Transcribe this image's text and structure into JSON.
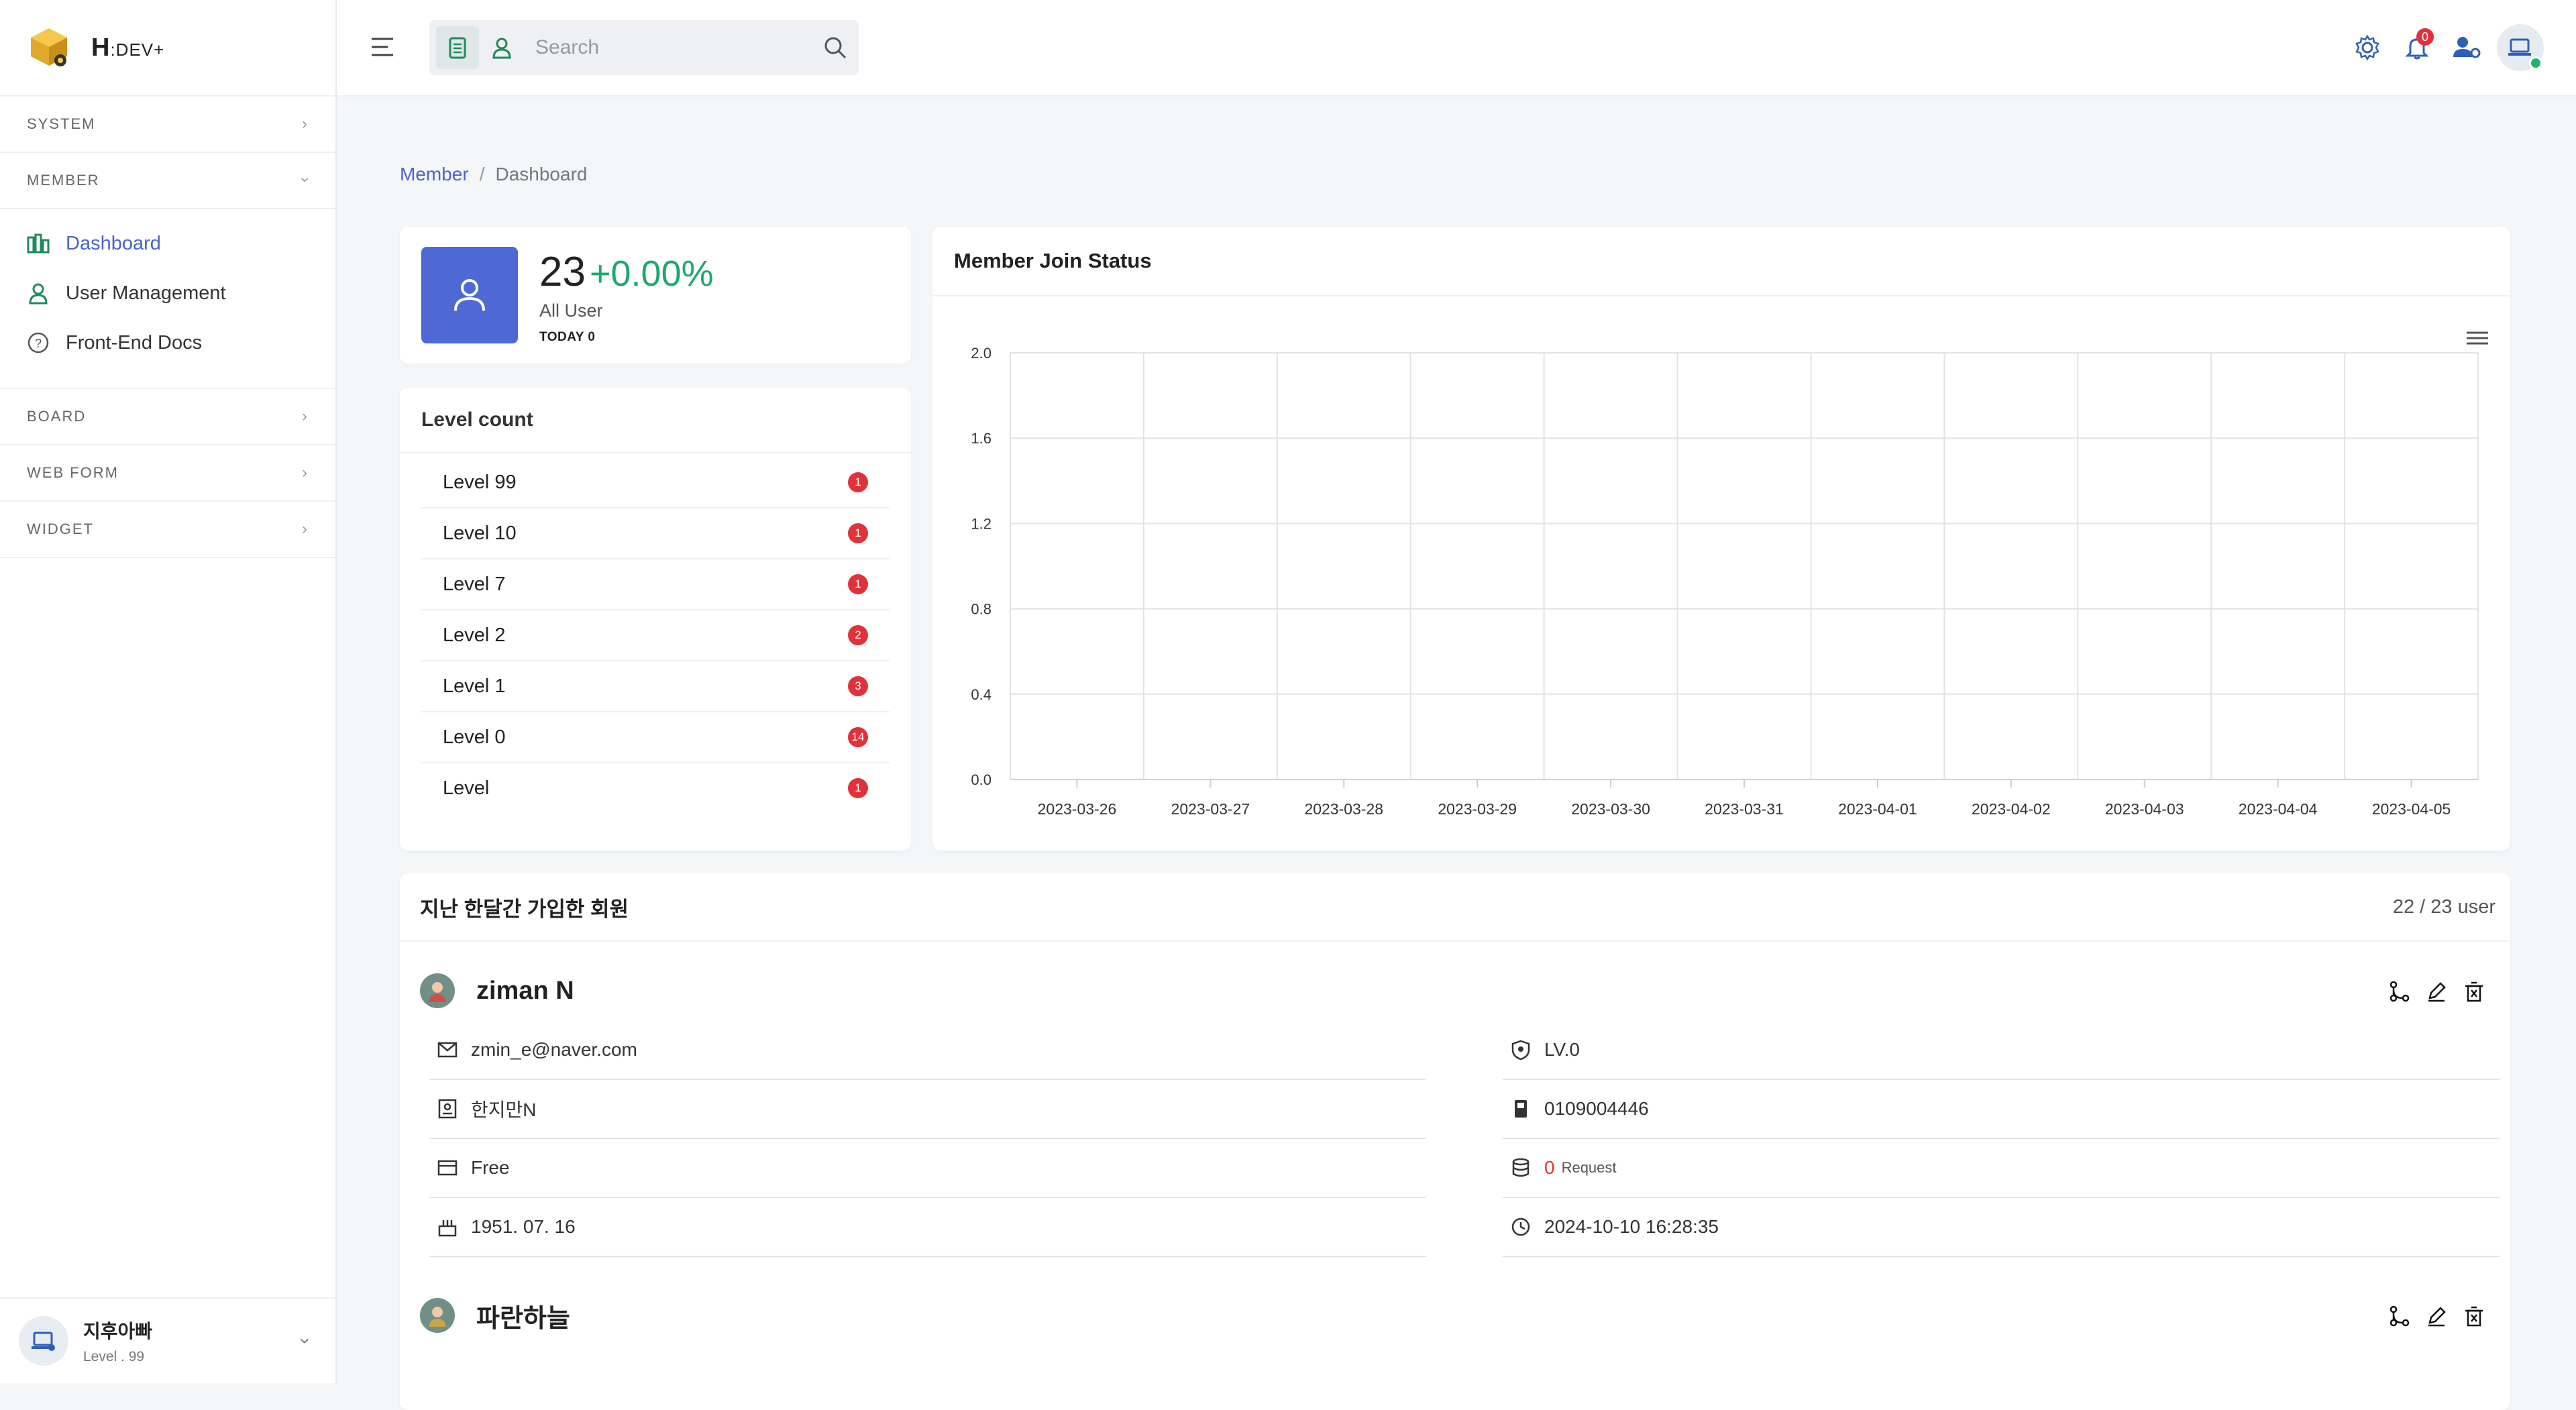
{
  "brand": {
    "name": "H",
    "suffix": ":DEV+"
  },
  "sidebar": {
    "sections": [
      {
        "label": "SYSTEM"
      },
      {
        "label": "MEMBER"
      },
      {
        "label": "BOARD"
      },
      {
        "label": "WEB FORM"
      },
      {
        "label": "WIDGET"
      }
    ],
    "member_items": [
      {
        "label": "Dashboard",
        "icon": "bar-chart-icon",
        "active": true
      },
      {
        "label": "User Management",
        "icon": "user-icon"
      },
      {
        "label": "Front-End Docs",
        "icon": "help-circle-icon"
      }
    ],
    "footer": {
      "name": "지후아빠",
      "level": "Level . 99"
    }
  },
  "header": {
    "search_placeholder": "Search",
    "notification_count": "0"
  },
  "breadcrumb": {
    "parent": "Member",
    "current": "Dashboard"
  },
  "stat": {
    "count": "23",
    "change": "+0.00%",
    "label": "All User",
    "today": "TODAY 0"
  },
  "level_count": {
    "title": "Level count",
    "rows": [
      {
        "label": "Level 99",
        "count": "1"
      },
      {
        "label": "Level 10",
        "count": "1"
      },
      {
        "label": "Level 7",
        "count": "1"
      },
      {
        "label": "Level 2",
        "count": "2"
      },
      {
        "label": "Level 1",
        "count": "3"
      },
      {
        "label": "Level 0",
        "count": "14"
      },
      {
        "label": "Level",
        "count": "1"
      }
    ]
  },
  "chart_data": {
    "type": "line",
    "title": "Member Join Status",
    "categories": [
      "2023-03-26",
      "2023-03-27",
      "2023-03-28",
      "2023-03-29",
      "2023-03-30",
      "2023-03-31",
      "2023-04-01",
      "2023-04-02",
      "2023-04-03",
      "2023-04-04",
      "2023-04-05"
    ],
    "series": [],
    "ylim": [
      0,
      2.0
    ],
    "yticks": [
      "2.0",
      "1.6",
      "1.2",
      "0.8",
      "0.4",
      "0.0"
    ],
    "grid": true
  },
  "members": {
    "title": "지난 한달간 가입한 회원",
    "count": "22 / 23 user",
    "list": [
      {
        "name": "ziman N",
        "email": "zmin_e@naver.com",
        "realname": "한지만N",
        "plan": "Free",
        "birth": "1951. 07. 16",
        "level": "LV.0",
        "phone": "0109004446",
        "requests": "0",
        "requests_label": "Request",
        "joined": "2024-10-10 16:28:35"
      },
      {
        "name": "파란하늘"
      }
    ]
  },
  "colors": {
    "accent": "#4b63c8",
    "positive": "#1fa86e",
    "badge": "#e0323a",
    "stat_box": "#4f69d4"
  }
}
